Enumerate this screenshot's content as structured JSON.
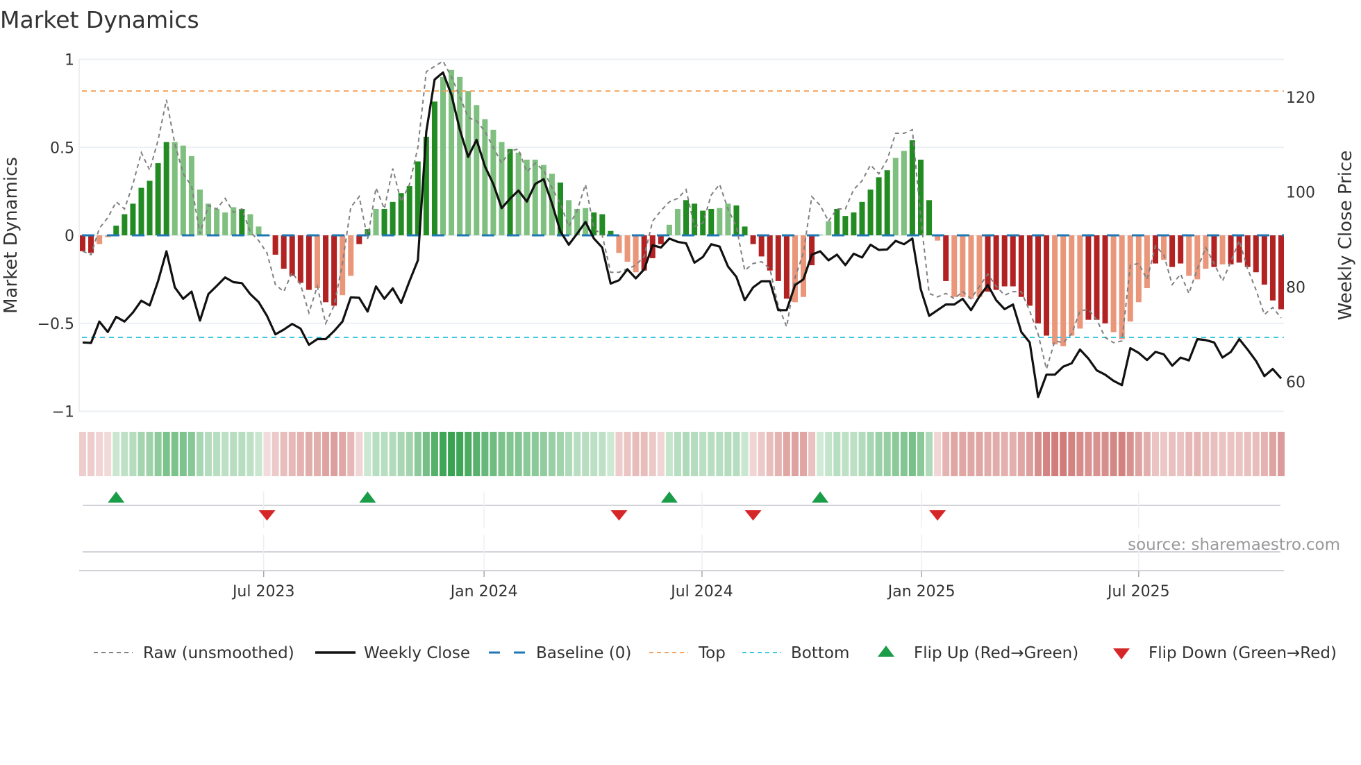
{
  "chart_data": {
    "type": "bar",
    "title": "Market Dynamics",
    "ylabel": "Market Dynamics",
    "y2label": "Weekly Close Price",
    "ylim": [
      -1,
      1
    ],
    "y2lim": [
      52,
      130
    ],
    "yticks": [
      "1",
      "0.5",
      "0",
      "−0.5",
      "−1"
    ],
    "ytick_values": [
      1,
      0.5,
      0,
      -0.5,
      -1
    ],
    "y2ticks": [
      "120",
      "100",
      "80",
      "60"
    ],
    "y2tick_values": [
      120,
      100,
      80,
      60
    ],
    "x_unit": "week index",
    "xticks": [
      {
        "label": "Jul 2023",
        "x": 21.6
      },
      {
        "label": "Jan 2024",
        "x": 47.9
      },
      {
        "label": "Jul 2024",
        "x": 73.9
      },
      {
        "label": "Jan 2025",
        "x": 100.1
      },
      {
        "label": "Jul 2025",
        "x": 126.0
      }
    ],
    "top_level": 0.82,
    "bottom_level": -0.58,
    "baseline": 0,
    "grid": true,
    "legend_position": "bottom",
    "series": [
      {
        "name": "Market Dynamics (smoothed)",
        "kind": "bar",
        "values": [
          -0.09,
          -0.1,
          -0.05,
          -0.01,
          0.055,
          0.12,
          0.18,
          0.27,
          0.31,
          0.41,
          0.53,
          0.53,
          0.51,
          0.45,
          0.26,
          0.18,
          0.15,
          0.13,
          0.16,
          0.15,
          0.12,
          0.05,
          -0.005,
          -0.11,
          -0.19,
          -0.23,
          -0.27,
          -0.31,
          -0.3,
          -0.38,
          -0.4,
          -0.34,
          -0.23,
          -0.05,
          0.035,
          0.15,
          0.15,
          0.19,
          0.24,
          0.28,
          0.42,
          0.56,
          0.76,
          0.9,
          0.94,
          0.9,
          0.82,
          0.74,
          0.66,
          0.6,
          0.53,
          0.49,
          0.47,
          0.43,
          0.43,
          0.4,
          0.35,
          0.3,
          0.2,
          0.15,
          0.155,
          0.13,
          0.12,
          0.025,
          -0.1,
          -0.15,
          -0.21,
          -0.2,
          -0.13,
          -0.05,
          0.06,
          0.15,
          0.2,
          0.18,
          0.14,
          0.15,
          0.155,
          0.18,
          0.17,
          0.05,
          -0.05,
          -0.12,
          -0.2,
          -0.26,
          -0.36,
          -0.38,
          -0.35,
          -0.17,
          0.005,
          0.08,
          0.15,
          0.11,
          0.13,
          0.19,
          0.26,
          0.33,
          0.37,
          0.44,
          0.48,
          0.54,
          0.43,
          0.2,
          -0.03,
          -0.26,
          -0.35,
          -0.35,
          -0.36,
          -0.35,
          -0.32,
          -0.31,
          -0.29,
          -0.29,
          -0.35,
          -0.4,
          -0.5,
          -0.57,
          -0.62,
          -0.63,
          -0.57,
          -0.53,
          -0.48,
          -0.48,
          -0.5,
          -0.55,
          -0.59,
          -0.49,
          -0.38,
          -0.3,
          -0.16,
          -0.14,
          -0.18,
          -0.16,
          -0.23,
          -0.25,
          -0.19,
          -0.18,
          -0.165,
          -0.165,
          -0.155,
          -0.18,
          -0.21,
          -0.28,
          -0.37,
          -0.42
        ],
        "shade": "ddlldddddddlllllllldllddddddldd lldd ldddddddlllllllldllllldlllddd llldddllddddllddddddd lldlldddddddllddd ldl lllddddddddllllddd llllldlddllldldddd",
        "colors": {
          "strong_up": "#228b22",
          "weak_up": "#7fbf7f",
          "strong_down": "#b22222",
          "weak_down": "#e9967a"
        }
      },
      {
        "name": "Raw (unsmoothed)",
        "kind": "line",
        "color": "#808080",
        "values": [
          -0.09,
          -0.11,
          0.04,
          0.1,
          0.19,
          0.15,
          0.29,
          0.47,
          0.37,
          0.54,
          0.77,
          0.52,
          0.35,
          0.28,
          0.01,
          0.17,
          0.15,
          0.21,
          0.13,
          0.15,
          0.02,
          -0.03,
          -0.1,
          -0.28,
          -0.32,
          -0.21,
          -0.28,
          -0.44,
          -0.29,
          -0.5,
          -0.4,
          -0.16,
          0.16,
          0.22,
          -0.02,
          0.27,
          0.15,
          0.38,
          0.19,
          0.29,
          0.5,
          0.93,
          0.96,
          0.99,
          0.9,
          0.79,
          0.67,
          0.65,
          0.59,
          0.5,
          0.41,
          0.48,
          0.49,
          0.36,
          0.41,
          0.37,
          0.27,
          0.18,
          0.05,
          0.14,
          0.29,
          0.04,
          0.0,
          -0.21,
          -0.21,
          -0.19,
          -0.17,
          -0.12,
          0.08,
          0.14,
          0.19,
          0.21,
          0.26,
          0.05,
          0.07,
          0.23,
          0.29,
          0.15,
          0.05,
          -0.2,
          -0.16,
          -0.15,
          -0.19,
          -0.4,
          -0.52,
          -0.24,
          -0.1,
          0.22,
          0.17,
          0.08,
          0.15,
          0.15,
          0.26,
          0.31,
          0.4,
          0.35,
          0.43,
          0.58,
          0.58,
          0.6,
          0.1,
          -0.33,
          -0.35,
          -0.33,
          -0.36,
          -0.32,
          -0.36,
          -0.29,
          -0.22,
          -0.29,
          -0.34,
          -0.32,
          -0.32,
          -0.43,
          -0.56,
          -0.76,
          -0.6,
          -0.61,
          -0.56,
          -0.43,
          -0.42,
          -0.48,
          -0.58,
          -0.61,
          -0.6,
          -0.17,
          -0.16,
          -0.25,
          -0.06,
          -0.11,
          -0.28,
          -0.22,
          -0.33,
          -0.19,
          -0.07,
          -0.16,
          -0.26,
          -0.15,
          -0.03,
          -0.19,
          -0.31,
          -0.45,
          -0.41,
          -0.47
        ]
      },
      {
        "name": "Weekly Close",
        "kind": "line",
        "axis": "right",
        "color": "#111111",
        "values": [
          68.3,
          68.2,
          72.7,
          70.5,
          73.7,
          72.7,
          74.6,
          77.1,
          76.1,
          81.2,
          87.5,
          79.9,
          77.5,
          79.0,
          72.9,
          78.5,
          80.2,
          82.0,
          81.0,
          80.8,
          78.5,
          76.8,
          73.9,
          70.0,
          71.0,
          72.2,
          71.2,
          67.8,
          69.0,
          69.0,
          70.7,
          72.7,
          77.8,
          77.7,
          74.8,
          80.1,
          77.5,
          79.7,
          76.6,
          81.2,
          85.6,
          112.7,
          123.7,
          125.2,
          120.5,
          113.2,
          107.4,
          111.0,
          105.4,
          101.7,
          96.6,
          98.6,
          100.3,
          98.0,
          101.7,
          102.7,
          97.6,
          91.7,
          88.9,
          91.2,
          93.7,
          90.2,
          88.3,
          80.7,
          81.4,
          83.7,
          81.8,
          83.7,
          88.8,
          88.3,
          90.2,
          89.5,
          89.2,
          85.1,
          86.3,
          89.0,
          88.5,
          84.3,
          82.1,
          77.2,
          79.9,
          81.2,
          81.2,
          75.1,
          75.1,
          80.4,
          81.6,
          86.8,
          87.5,
          85.6,
          86.8,
          84.6,
          87.0,
          86.2,
          88.9,
          87.8,
          87.9,
          89.7,
          89.0,
          90.2,
          79.5,
          73.9,
          75.1,
          76.3,
          76.3,
          77.5,
          75.1,
          78.0,
          80.4,
          77.2,
          75.3,
          76.3,
          70.5,
          68.3,
          56.8,
          61.5,
          61.5,
          63.2,
          63.9,
          66.8,
          64.9,
          62.4,
          61.5,
          60.2,
          59.3,
          67.1,
          66.1,
          64.6,
          66.3,
          65.8,
          63.4,
          65.1,
          64.5,
          69.0,
          68.8,
          68.3,
          65.1,
          66.3,
          69.0,
          66.8,
          64.4,
          61.2,
          62.7,
          60.7
        ]
      }
    ],
    "flips": [
      {
        "x": 4,
        "type": "up"
      },
      {
        "x": 22,
        "type": "down"
      },
      {
        "x": 34,
        "type": "up"
      },
      {
        "x": 64,
        "type": "down"
      },
      {
        "x": 70,
        "type": "up"
      },
      {
        "x": 80,
        "type": "down"
      },
      {
        "x": 88,
        "type": "up"
      },
      {
        "x": 102,
        "type": "down"
      }
    ],
    "legend": [
      {
        "label": "Raw (unsmoothed)",
        "style": "raw"
      },
      {
        "label": "Weekly Close",
        "style": "close"
      },
      {
        "label": "Baseline (0)",
        "style": "baseline"
      },
      {
        "label": "Top",
        "style": "top"
      },
      {
        "label": "Bottom",
        "style": "bottom"
      },
      {
        "label": "Flip Up (Red→Green)",
        "style": "flip-up"
      },
      {
        "label": "Flip Down (Green→Red)",
        "style": "flip-down"
      }
    ],
    "colors": {
      "top": "#f4a460",
      "bottom": "#3cc8e0",
      "baseline": "#1f77b4",
      "flip_up": "#1a9c48",
      "flip_down": "#d62728",
      "heat_up": "#2e9e48",
      "heat_down": "#c0504d"
    },
    "source": "source: sharemaestro.com"
  }
}
